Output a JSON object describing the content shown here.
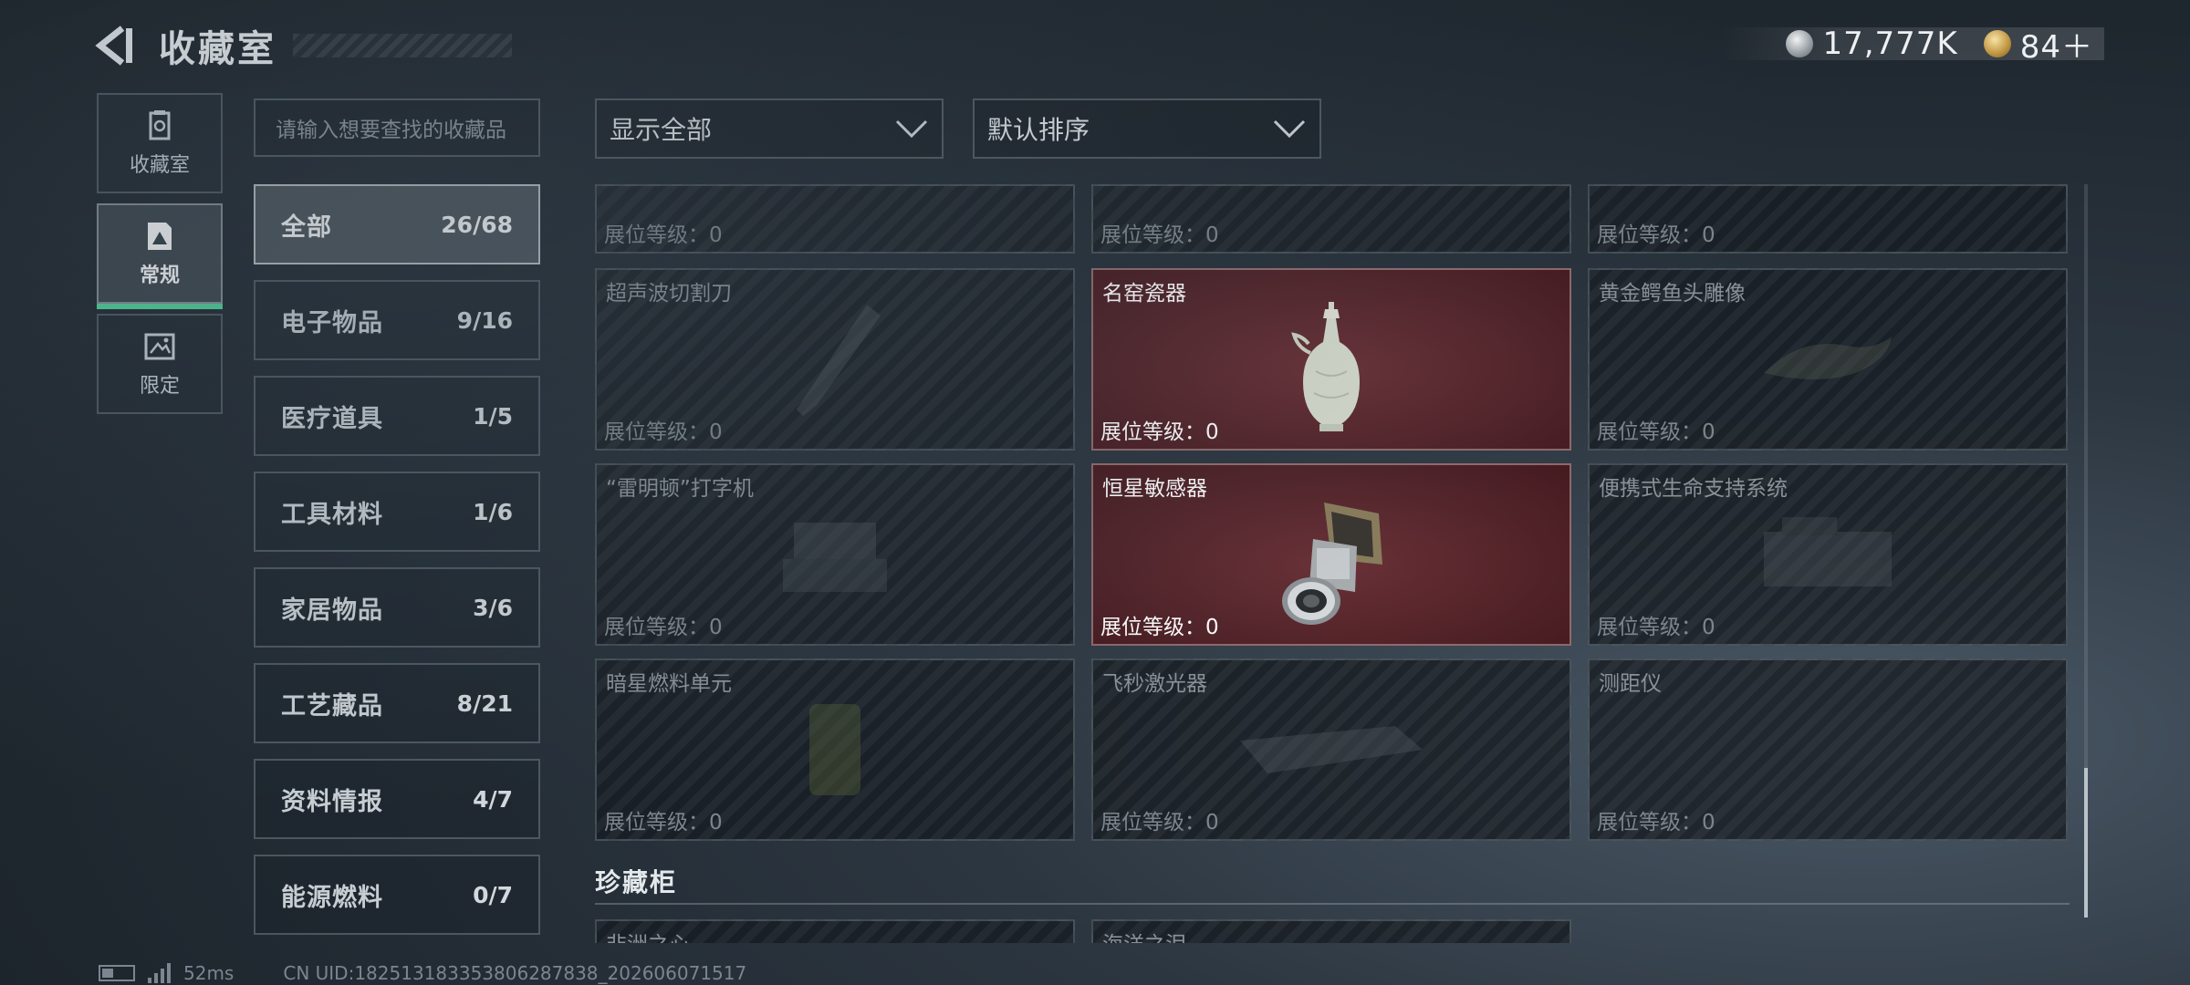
{
  "header": {
    "title": "收藏室",
    "currency": [
      {
        "icon": "silver-coin-icon",
        "value": "17,777K"
      },
      {
        "icon": "gold-coin-icon",
        "value": "84＋"
      }
    ]
  },
  "leftnav": [
    {
      "label": "收藏室",
      "icon": "collection-room-icon",
      "active": false
    },
    {
      "label": "常规",
      "icon": "regular-icon",
      "active": true
    },
    {
      "label": "限定",
      "icon": "limited-icon",
      "active": false
    }
  ],
  "search": {
    "placeholder": "请输入想要查找的收藏品"
  },
  "categories": [
    {
      "label": "全部",
      "count": "26/68",
      "active": true
    },
    {
      "label": "电子物品",
      "count": "9/16"
    },
    {
      "label": "医疗道具",
      "count": "1/5"
    },
    {
      "label": "工具材料",
      "count": "1/6"
    },
    {
      "label": "家居物品",
      "count": "3/6"
    },
    {
      "label": "工艺藏品",
      "count": "8/21"
    },
    {
      "label": "资料情报",
      "count": "4/7"
    },
    {
      "label": "能源燃料",
      "count": "0/7"
    }
  ],
  "filters": {
    "display": "显示全部",
    "sort": "默认排序"
  },
  "items": [
    {
      "name": "",
      "level": "展位等级：0",
      "owned": false
    },
    {
      "name": "",
      "level": "展位等级：0",
      "owned": false
    },
    {
      "name": "",
      "level": "展位等级：0",
      "owned": false
    },
    {
      "name": "超声波切割刀",
      "level": "展位等级：0",
      "owned": false
    },
    {
      "name": "名窑瓷器",
      "level": "展位等级：0",
      "owned": true
    },
    {
      "name": "黄金鳄鱼头雕像",
      "level": "展位等级：0",
      "owned": false
    },
    {
      "name": "“雷明顿”打字机",
      "level": "展位等级：0",
      "owned": false
    },
    {
      "name": "恒星敏感器",
      "level": "展位等级：0",
      "owned": true
    },
    {
      "name": "便携式生命支持系统",
      "level": "展位等级：0",
      "owned": false
    },
    {
      "name": "暗星燃料单元",
      "level": "展位等级：0",
      "owned": false
    },
    {
      "name": "飞秒激光器",
      "level": "展位等级：0",
      "owned": false
    },
    {
      "name": "测距仪",
      "level": "展位等级：0",
      "owned": false
    }
  ],
  "section": {
    "title": "珍藏柜",
    "items": [
      "非洲之心",
      "海洋之泪"
    ]
  },
  "footer": {
    "ping": "52ms",
    "uid": "CN UID:18251318335380628783​8_202606071517"
  }
}
